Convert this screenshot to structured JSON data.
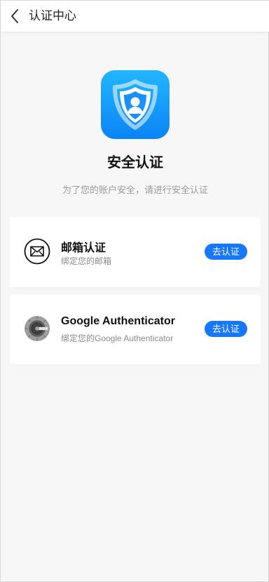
{
  "header": {
    "title": "认证中心",
    "back_icon": "chevron-left-icon"
  },
  "hero": {
    "icon": "shield-user-icon",
    "title": "安全认证",
    "subtitle": "为了您的账户安全，请进行安全认证"
  },
  "methods": [
    {
      "icon": "envelope-icon",
      "title": "邮箱认证",
      "description": "绑定您的邮箱",
      "button_label": "去认证"
    },
    {
      "icon": "google-authenticator-icon",
      "title": "Google Authenticator",
      "description": "绑定您的Google Authenticator",
      "button_label": "去认证"
    }
  ],
  "colors": {
    "accent": "#1677ff",
    "background": "#f7f7f8",
    "logo_gradient_top": "#23b6ff",
    "logo_gradient_bottom": "#0a84f5"
  }
}
